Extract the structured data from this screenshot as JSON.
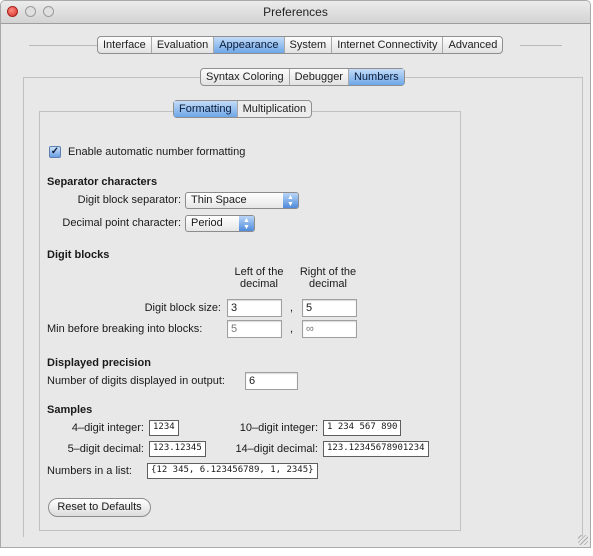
{
  "window": {
    "title": "Preferences"
  },
  "main_tabs": [
    "Interface",
    "Evaluation",
    "Appearance",
    "System",
    "Internet Connectivity",
    "Advanced"
  ],
  "appearance_tabs": [
    "Syntax Coloring",
    "Debugger",
    "Numbers"
  ],
  "numbers_tabs": [
    "Formatting",
    "Multiplication"
  ],
  "formatting": {
    "enable_label": "Enable automatic number formatting",
    "enable_checked": true,
    "separator": {
      "heading": "Separator characters",
      "digit_block_label": "Digit block separator:",
      "digit_block_value": "Thin Space",
      "decimal_point_label": "Decimal point character:",
      "decimal_point_value": "Period"
    },
    "digit_blocks": {
      "heading": "Digit blocks",
      "left_header_1": "Left of the",
      "left_header_2": "decimal",
      "right_header_1": "Right of the",
      "right_header_2": "decimal",
      "block_size_label": "Digit block size:",
      "block_size_left": "3",
      "block_size_right": "5",
      "min_label": "Min before breaking into blocks:",
      "min_left": "5",
      "min_right": "∞",
      "comma": ","
    },
    "precision": {
      "heading": "Displayed precision",
      "label": "Number of digits displayed in output:",
      "value": "6"
    },
    "samples": {
      "heading": "Samples",
      "int4_label": "4–digit integer:",
      "int4_value": "1234",
      "int10_label": "10–digit integer:",
      "int10_value": "1 234 567 890",
      "dec5_label": "5–digit decimal:",
      "dec5_value": "123.12345",
      "dec14_label": "14–digit decimal:",
      "dec14_value": "123.12345678901234",
      "list_label": "Numbers in a list:",
      "list_value": "{12 345, 6.123456789, 1, 2345}"
    },
    "reset_label": "Reset to Defaults"
  }
}
